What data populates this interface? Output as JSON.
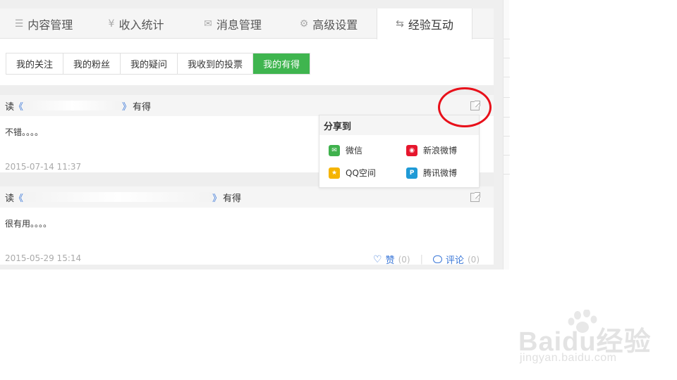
{
  "tabs": [
    {
      "label": "内容管理",
      "icon": "list-icon",
      "glyph": "☰"
    },
    {
      "label": "收入统计",
      "icon": "yen-icon",
      "glyph": "¥"
    },
    {
      "label": "消息管理",
      "icon": "envelope-icon",
      "glyph": "✉"
    },
    {
      "label": "高级设置",
      "icon": "gear-icon",
      "glyph": "⚙"
    },
    {
      "label": "经验互动",
      "icon": "swap-icon",
      "glyph": "⇆"
    }
  ],
  "subtabs": [
    "我的关注",
    "我的粉丝",
    "我的疑问",
    "我收到的投票",
    "我的有得"
  ],
  "cards": [
    {
      "prefix": "读",
      "open_quote": "《",
      "close_quote": "》",
      "suffix": "有得",
      "body": "不错。。。。",
      "time": "2015-07-14 11:37"
    },
    {
      "prefix": "读",
      "open_quote": "《",
      "close_quote": "》",
      "suffix": "有得",
      "body": "很有用。。。。",
      "time": "2015-05-29 15:14",
      "like_label": "赞",
      "like_count": "(0)",
      "comment_label": "评论",
      "comment_count": "(0)"
    }
  ],
  "share_popup": {
    "title": "分享到",
    "items": [
      {
        "label": "微信",
        "icon": "wechat-icon",
        "color": "#3fb14d"
      },
      {
        "label": "新浪微博",
        "icon": "sina-weibo-icon",
        "color": "#e6162d"
      },
      {
        "label": "QQ空间",
        "icon": "qzone-icon",
        "color": "#f5b400"
      },
      {
        "label": "腾讯微博",
        "icon": "tencent-weibo-icon",
        "color": "#1f9ad6"
      }
    ]
  },
  "colors": {
    "accent_green": "#3fb54f",
    "link_blue": "#3c78d8",
    "annotation_red": "#e8101a"
  },
  "watermark": {
    "brand": "Baidu经验",
    "url": "jingyan.baidu.com"
  }
}
